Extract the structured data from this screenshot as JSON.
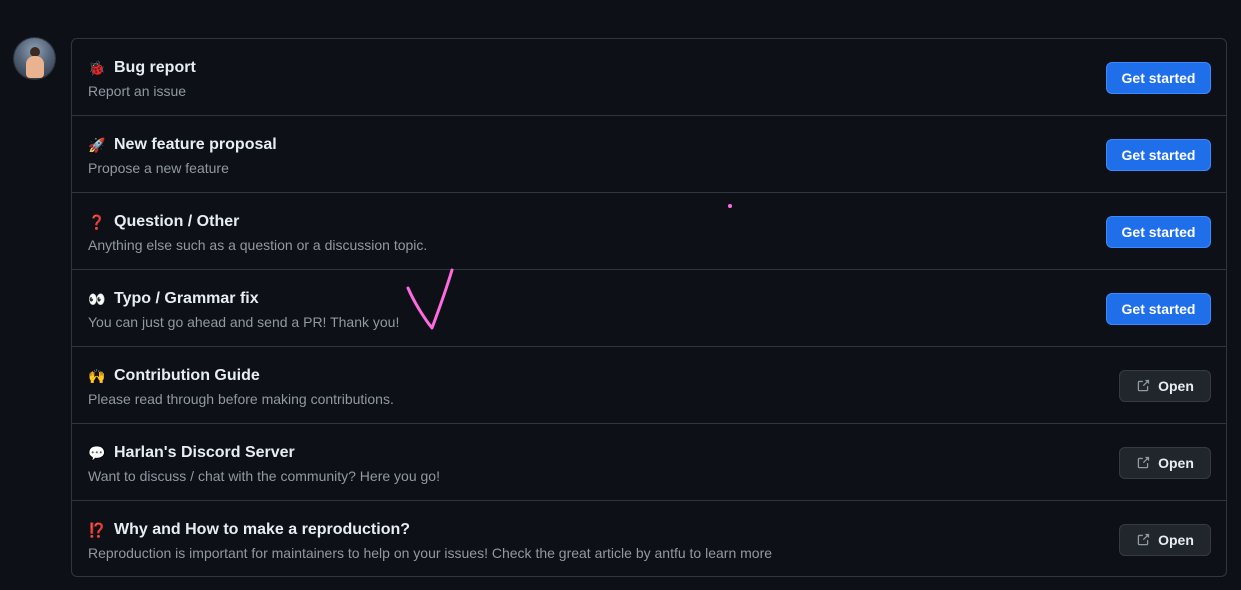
{
  "templates": [
    {
      "emoji": "🐞",
      "title": "Bug report",
      "description": "Report an issue",
      "action": "Get started",
      "kind": "primary"
    },
    {
      "emoji": "🚀",
      "title": "New feature proposal",
      "description": "Propose a new feature",
      "action": "Get started",
      "kind": "primary"
    },
    {
      "emoji": "❓",
      "title": "Question / Other",
      "description": "Anything else such as a question or a discussion topic.",
      "action": "Get started",
      "kind": "primary"
    }
  ],
  "typo": {
    "emoji": "👀",
    "title": "Typo / Grammar fix",
    "description": "You can just go ahead and send a PR! Thank you!",
    "action": "Get started"
  },
  "links": [
    {
      "emoji": "🙌",
      "title": "Contribution Guide",
      "description": "Please read through before making contributions.",
      "action": "Open"
    },
    {
      "emoji": "💬",
      "title": "Harlan's Discord Server",
      "description": "Want to discuss / chat with the community? Here you go!",
      "action": "Open"
    },
    {
      "emoji": "⁉️",
      "title": "Why and How to make a reproduction?",
      "description": "Reproduction is important for maintainers to help on your issues! Check the great article by antfu to learn more",
      "action": "Open"
    }
  ],
  "colors": {
    "background": "#0d1117",
    "border": "#30363d",
    "primary_button": "#1f6feb",
    "secondary_button": "#21262d",
    "muted_text": "#9198a1",
    "annotation": "#ff6bde"
  },
  "icons": {
    "external_link": "external-link-icon",
    "avatar": "user-avatar"
  }
}
